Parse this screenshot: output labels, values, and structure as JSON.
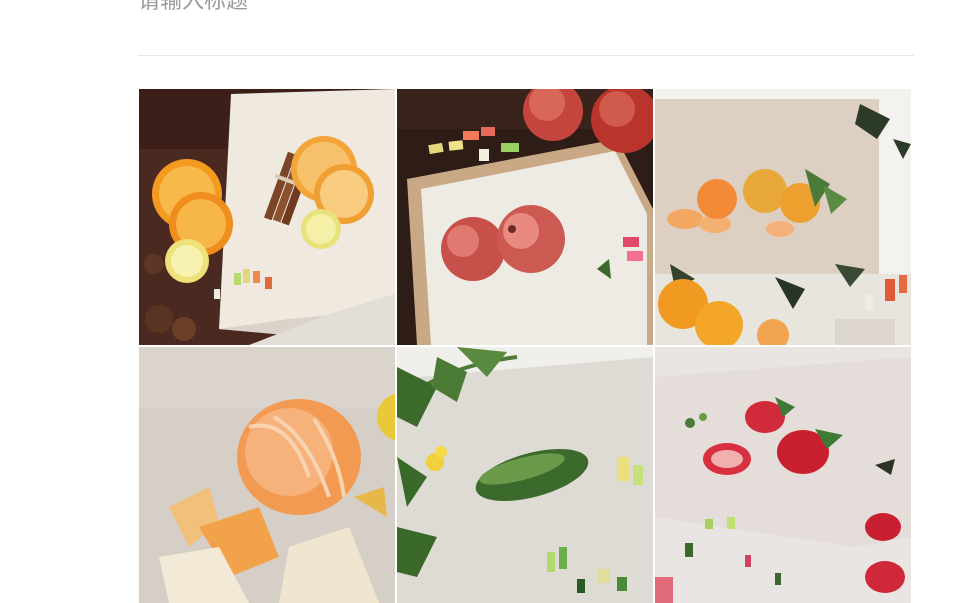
{
  "editor": {
    "title_placeholder": "请输入标题"
  },
  "gallery": {
    "images": [
      {
        "subject": "oranges-and-cinnamon-pastel-drawing"
      },
      {
        "subject": "pomegranates-pastel-drawing"
      },
      {
        "subject": "tangerines-pastel-drawing"
      },
      {
        "subject": "peeled-tangerine-pastel-drawing"
      },
      {
        "subject": "cucumber-pastel-drawing"
      },
      {
        "subject": "strawberries-pastel-drawing"
      }
    ]
  }
}
